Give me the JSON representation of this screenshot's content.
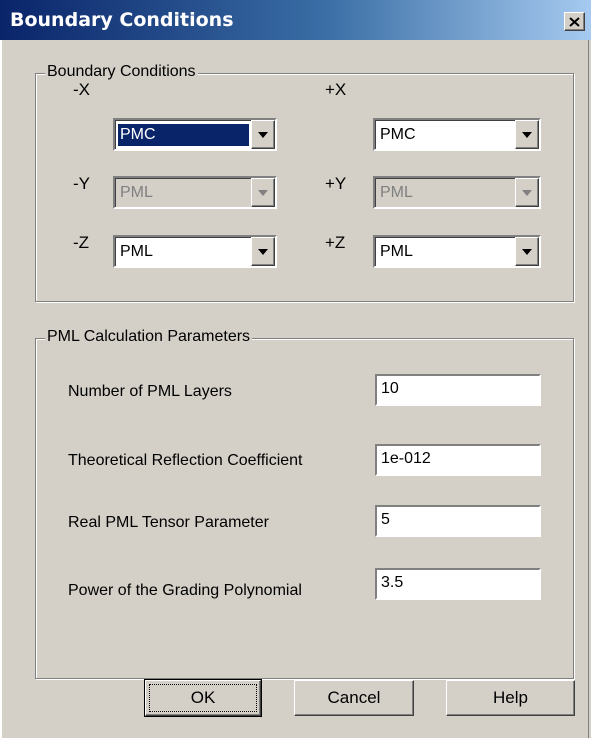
{
  "window": {
    "title": "Boundary Conditions"
  },
  "boundary": {
    "legend": "Boundary Conditions",
    "minus_x": {
      "label": "-X",
      "value": "PMC",
      "enabled": true,
      "selected": true
    },
    "plus_x": {
      "label": "+X",
      "value": "PMC",
      "enabled": true
    },
    "minus_y": {
      "label": "-Y",
      "value": "PML",
      "enabled": false
    },
    "plus_y": {
      "label": "+Y",
      "value": "PML",
      "enabled": false
    },
    "minus_z": {
      "label": "-Z",
      "value": "PML",
      "enabled": true
    },
    "plus_z": {
      "label": "+Z",
      "value": "PML",
      "enabled": true
    }
  },
  "pml": {
    "legend": "PML Calculation Parameters",
    "layers": {
      "label": "Number of PML Layers",
      "value": "10"
    },
    "reflection": {
      "label": "Theoretical Reflection Coefficient",
      "value": "1e-012"
    },
    "tensor": {
      "label": "Real PML Tensor Parameter",
      "value": "5"
    },
    "grading": {
      "label": "Power of the Grading Polynomial",
      "value": "3.5"
    }
  },
  "buttons": {
    "ok": "OK",
    "cancel": "Cancel",
    "help": "Help"
  },
  "icons": {
    "close": "close-icon",
    "dropdown": "chevron-down-icon"
  },
  "colors": {
    "titlebar_start": "#0a246a",
    "titlebar_end": "#a6caf0",
    "dialog_bg": "#d4d0c8",
    "selection": "#0a246a"
  }
}
